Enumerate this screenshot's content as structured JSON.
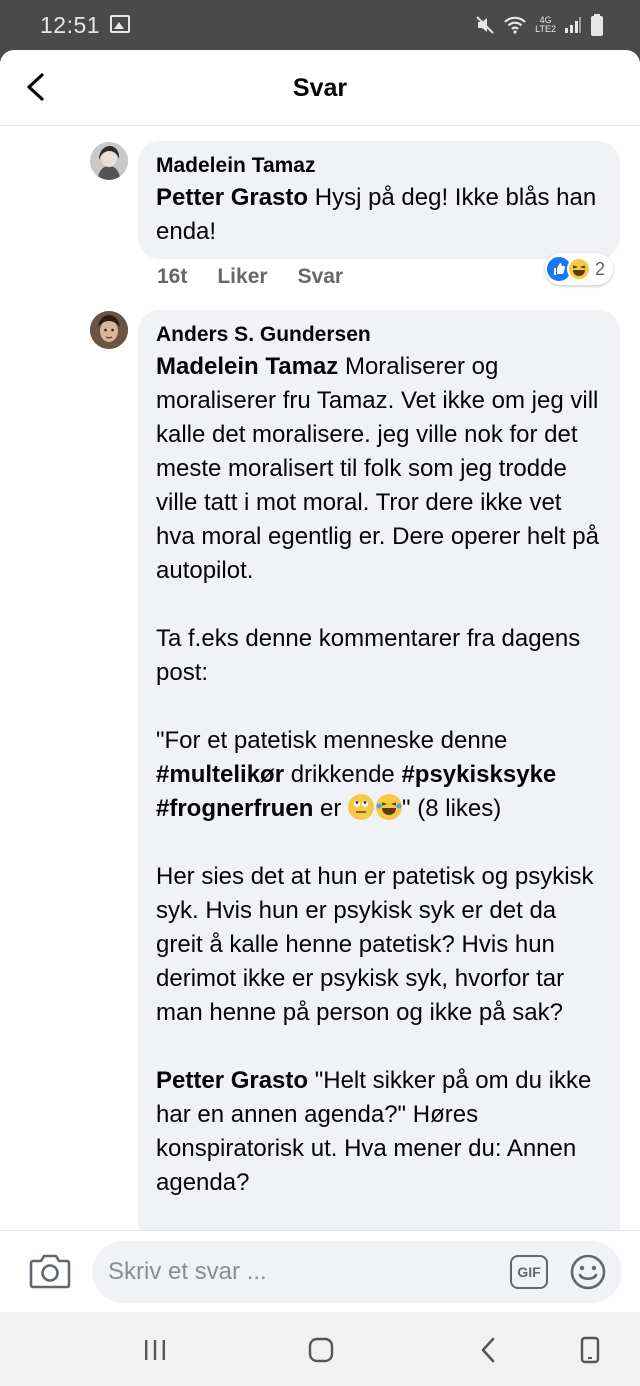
{
  "status_bar": {
    "time": "12:51",
    "network": "4G",
    "network_sub": "LTE2"
  },
  "header": {
    "title": "Svar"
  },
  "comments": [
    {
      "author": "Madelein Tamaz",
      "mention": "Petter Grasto",
      "text": " Hysj på deg! Ikke blås han enda!",
      "time": "16t",
      "like_label": "Liker",
      "reply_label": "Svar",
      "reaction_count": "2"
    },
    {
      "author": "Anders S. Gundersen",
      "p1_mention": "Madelein Tamaz",
      "p1_text": " Moraliserer og moraliserer fru Tamaz. Vet ikke om jeg vill kalle det moralisere. jeg ville nok for det meste moralisert til folk som jeg trodde ville tatt i mot moral. Tror dere ikke vet hva moral egentlig er. Dere operer helt på autopilot.",
      "p2_text": "Ta f.eks denne kommentarer fra dagens post:",
      "p3_a": "\"For et patetisk menneske denne ",
      "p3_tag1": "#multelikør",
      "p3_b": " drikkende ",
      "p3_tag2": "#psykisksyke",
      "p3_tag3": "#frognerfruen",
      "p3_c": " er ",
      "p3_d": "\" (8 likes)",
      "p4_text": "Her sies det at hun er patetisk og psykisk syk. Hvis hun er psykisk syk er det da greit å kalle henne patetisk? Hvis hun derimot ikke er psykisk syk, hvorfor tar man henne på person og ikke på sak?",
      "p5_mention": "Petter Grasto",
      "p5_text": " \"Helt sikker på om du ikke har en annen agenda?\" Høres konspiratorisk ut. Hva mener du: Annen agenda?"
    }
  ],
  "composer": {
    "placeholder": "Skriv et svar ...",
    "gif_label": "GIF"
  },
  "colors": {
    "bubble": "#f0f2f5",
    "like_blue": "#1877f2",
    "meta_gray": "#65676b"
  }
}
